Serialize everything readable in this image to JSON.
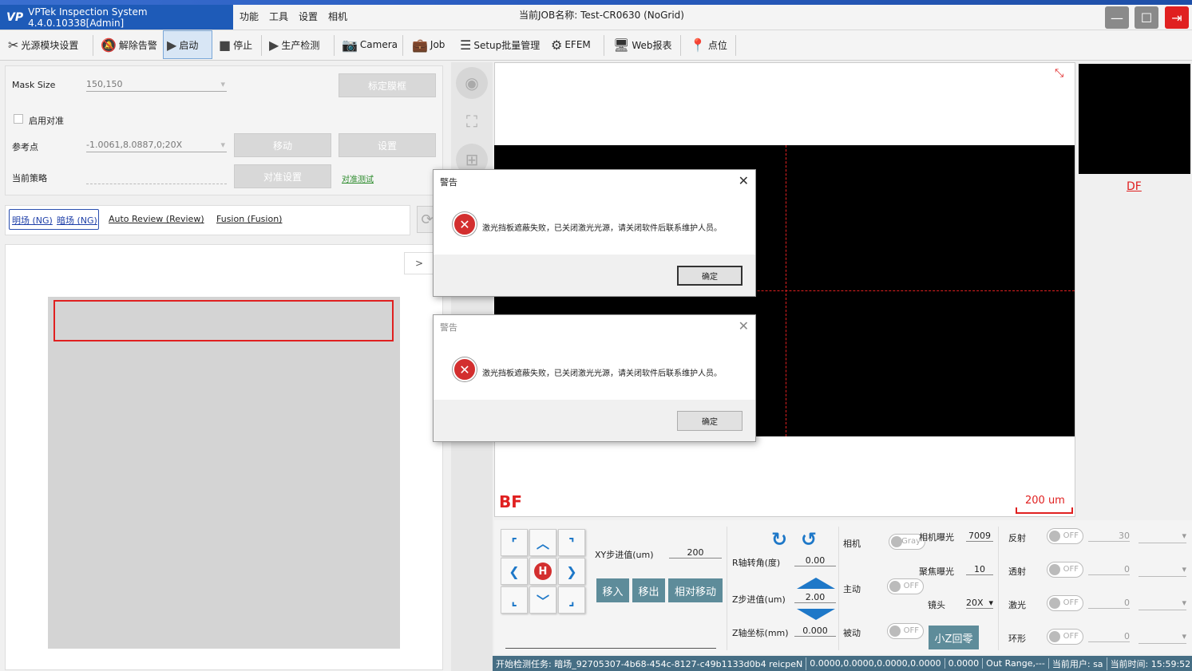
{
  "app": {
    "title": "VPTek Inspection System 4.4.0.10338[Admin]",
    "logo": "VP",
    "job_label": "当前JOB名称: Test-CR0630 (NoGrid)"
  },
  "menu": [
    "功能",
    "工具",
    "设置",
    "相机"
  ],
  "toolbar": [
    {
      "label": "光源模块设置",
      "icon": "tools-icon"
    },
    {
      "label": "解除告警",
      "icon": "bell-off-icon"
    },
    {
      "label": "启动",
      "icon": "play-icon"
    },
    {
      "label": "停止",
      "icon": "stop-icon"
    },
    {
      "label": "生产检测",
      "icon": "play-icon"
    },
    {
      "label": "Camera",
      "icon": "camera-icon"
    },
    {
      "label": "Job",
      "icon": "briefcase-icon"
    },
    {
      "label": "Setup批量管理",
      "icon": "list-icon"
    },
    {
      "label": "EFEM",
      "icon": "robot-icon"
    },
    {
      "label": "Web报表",
      "icon": "monitor-icon"
    },
    {
      "label": "点位",
      "icon": "pin-icon"
    }
  ],
  "settings": {
    "mask_size_label": "Mask Size",
    "mask_size_value": "150,150",
    "calib_btn": "标定膜框",
    "enable_align_label": "启用对准",
    "ref_point_label": "参考点",
    "ref_point_value": "-1.0061,8.0887,0;20X",
    "move_btn": "移动",
    "set_btn": "设置",
    "strategy_label": "当前策略",
    "align_settings_btn": "对准设置",
    "align_test_link": "对准测试"
  },
  "tabs": {
    "bright": "明场 (NG)",
    "dark": "暗场 (NG)",
    "auto_review": "Auto Review (Review)",
    "fusion": "Fusion (Fusion)",
    "expand": ">"
  },
  "view": {
    "bf_label": "BF",
    "df_label": "DF",
    "scale_label": "200 um"
  },
  "colors": {
    "accent": "#1e5bb8",
    "error": "#e02020",
    "teal": "#5e8c9a",
    "status_bg": "#466e84"
  },
  "dialogs": [
    {
      "title": "警告",
      "message": "激光挡板遮蔽失败，已关闭激光光源，请关闭软件后联系维护人员。",
      "ok": "确定"
    },
    {
      "title": "警告",
      "message": "激光挡板遮蔽失败，已关闭激光光源，请关闭软件后联系维护人员。",
      "ok": "确定"
    }
  ],
  "controls": {
    "home": "H",
    "xy_step_label": "XY步进值(um)",
    "xy_step_value": "200",
    "move_in": "移入",
    "move_out": "移出",
    "rel_move": "相对移动",
    "r_angle_label": "R轴转角(度)",
    "r_angle_value": "0.00",
    "z_step_label": "Z步进值(um)",
    "z_step_value": "2.00",
    "z_coord_label": "Z轴坐标(mm)",
    "z_coord_value": "0.000",
    "camera_label": "相机",
    "active_label": "主动",
    "passive_label": "被动",
    "gray": "Gray",
    "off": "OFF",
    "cam_exposure_label": "相机曝光",
    "cam_exposure_value": "7009",
    "focus_exposure_label": "聚焦曝光",
    "focus_exposure_value": "10",
    "lens_label": "镜头",
    "lens_value": "20X",
    "small_z_home": "小Z回零",
    "reflect_label": "反射",
    "reflect_value": "30",
    "transmit_label": "透射",
    "transmit_value": "0",
    "laser_label": "激光",
    "laser_value": "0",
    "ring_label": "环形",
    "ring_value": "0"
  },
  "status": [
    "开始检测任务: 暗场_92705307-4b68-454c-8127-c49b1133d0b4 reicpeN",
    "0.0000,0.0000,0.0000,0.0000",
    "0.0000",
    "Out Range,---",
    "当前用户: sa",
    "当前时间: 15:59:52"
  ]
}
